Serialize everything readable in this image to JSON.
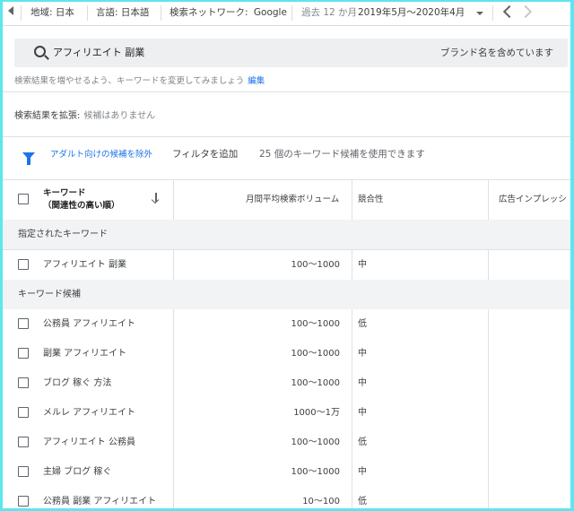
{
  "topbar": {
    "location": "地域: 日本",
    "language": "言語: 日本語",
    "network_label": "検索ネットワーク:",
    "network_value": "Google",
    "period_label": "過去 12 か月",
    "period_value": "2019年5月～2020年4月"
  },
  "search": {
    "query": "アフィリエイト 副業",
    "brand_text": "ブランド名を含めています"
  },
  "hint": {
    "text": "検索結果を増やせるよう、キーワードを変更してみましょう",
    "edit_link": "編集"
  },
  "expand": {
    "label": "検索結果を拡張:",
    "value": "候補はありません"
  },
  "filters": {
    "adult_filter": "アダルト向けの候補を除外",
    "add_filter": "フィルタを追加",
    "count_text": "25 個のキーワード候補を使用できます"
  },
  "table": {
    "col_keyword": "キーワード",
    "col_keyword_sub": "（関連性の高い順）",
    "col_volume": "月間平均検索ボリューム",
    "col_competition": "競合性",
    "col_impression": "広告インプレッシ",
    "group_specified": "指定されたキーワード",
    "group_suggested": "キーワード候補",
    "specified_rows": [
      {
        "keyword": "アフィリエイト 副業",
        "volume": "100～1000",
        "competition": "中"
      }
    ],
    "suggested_rows": [
      {
        "keyword": "公務員 アフィリエイト",
        "volume": "100～1000",
        "competition": "低"
      },
      {
        "keyword": "副業 アフィリエイト",
        "volume": "100～1000",
        "competition": "中"
      },
      {
        "keyword": "ブログ 稼ぐ 方法",
        "volume": "100～1000",
        "competition": "中"
      },
      {
        "keyword": "メルレ アフィリエイト",
        "volume": "1000～1万",
        "competition": "中"
      },
      {
        "keyword": "アフィリエイト 公務員",
        "volume": "100～1000",
        "competition": "低"
      },
      {
        "keyword": "主婦 ブログ 稼ぐ",
        "volume": "100～1000",
        "competition": "中"
      },
      {
        "keyword": "公務員 副業 アフィリエイト",
        "volume": "10～100",
        "competition": "低"
      }
    ]
  },
  "colors": {
    "accent": "#1a73e8",
    "border_frame": "#5ee6ee"
  }
}
